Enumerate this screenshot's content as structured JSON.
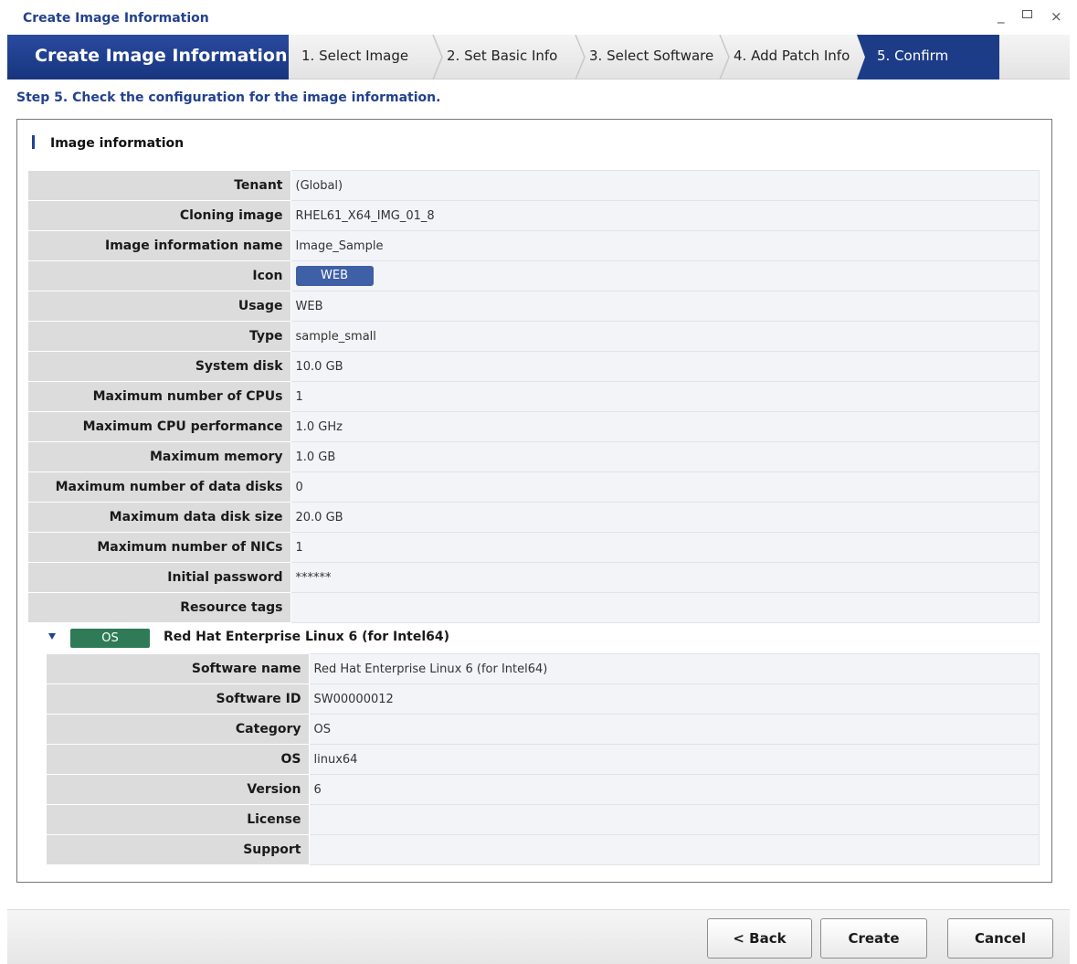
{
  "window": {
    "title": "Create Image Information",
    "controls": {
      "minimize": "_",
      "maximize": "",
      "close": "×"
    }
  },
  "wizard": {
    "title": "Create Image Information",
    "steps": [
      {
        "label": "1. Select Image"
      },
      {
        "label": "2. Set Basic Info"
      },
      {
        "label": "3. Select Software"
      },
      {
        "label": "4. Add Patch Info"
      },
      {
        "label": "5. Confirm",
        "active": true
      }
    ]
  },
  "heading": "Step 5. Check the configuration for the image information.",
  "image_info": {
    "section_title": "Image information",
    "rows": [
      {
        "label": "Tenant",
        "value": "(Global)"
      },
      {
        "label": "Cloning image",
        "value": "RHEL61_X64_IMG_01_8"
      },
      {
        "label": "Image information name",
        "value": "Image_Sample"
      },
      {
        "label": "Icon",
        "value": "WEB"
      },
      {
        "label": "Usage",
        "value": "WEB"
      },
      {
        "label": "Type",
        "value": "sample_small"
      },
      {
        "label": "System disk",
        "value": "10.0 GB"
      },
      {
        "label": "Maximum number of CPUs",
        "value": "1"
      },
      {
        "label": "Maximum CPU performance",
        "value": "1.0 GHz"
      },
      {
        "label": "Maximum memory",
        "value": "1.0 GB"
      },
      {
        "label": "Maximum number of data disks",
        "value": "0"
      },
      {
        "label": "Maximum data disk size",
        "value": "20.0 GB"
      },
      {
        "label": "Maximum number of NICs",
        "value": "1"
      },
      {
        "label": "Initial password",
        "value": "******"
      },
      {
        "label": "Resource tags",
        "value": ""
      }
    ]
  },
  "software": {
    "badge": "OS",
    "title": "Red Hat Enterprise Linux 6 (for Intel64)",
    "rows": [
      {
        "label": "Software name",
        "value": "Red Hat Enterprise Linux 6 (for Intel64)"
      },
      {
        "label": "Software ID",
        "value": "SW00000012"
      },
      {
        "label": "Category",
        "value": "OS"
      },
      {
        "label": "OS",
        "value": "linux64"
      },
      {
        "label": "Version",
        "value": "6"
      },
      {
        "label": "License",
        "value": ""
      },
      {
        "label": "Support",
        "value": ""
      }
    ]
  },
  "buttons": {
    "back": "< Back",
    "create": "Create",
    "cancel": "Cancel"
  },
  "colors": {
    "brand_blue": "#1d3c88",
    "os_green": "#2f7a57",
    "icon_badge": "#3f5fa6"
  }
}
